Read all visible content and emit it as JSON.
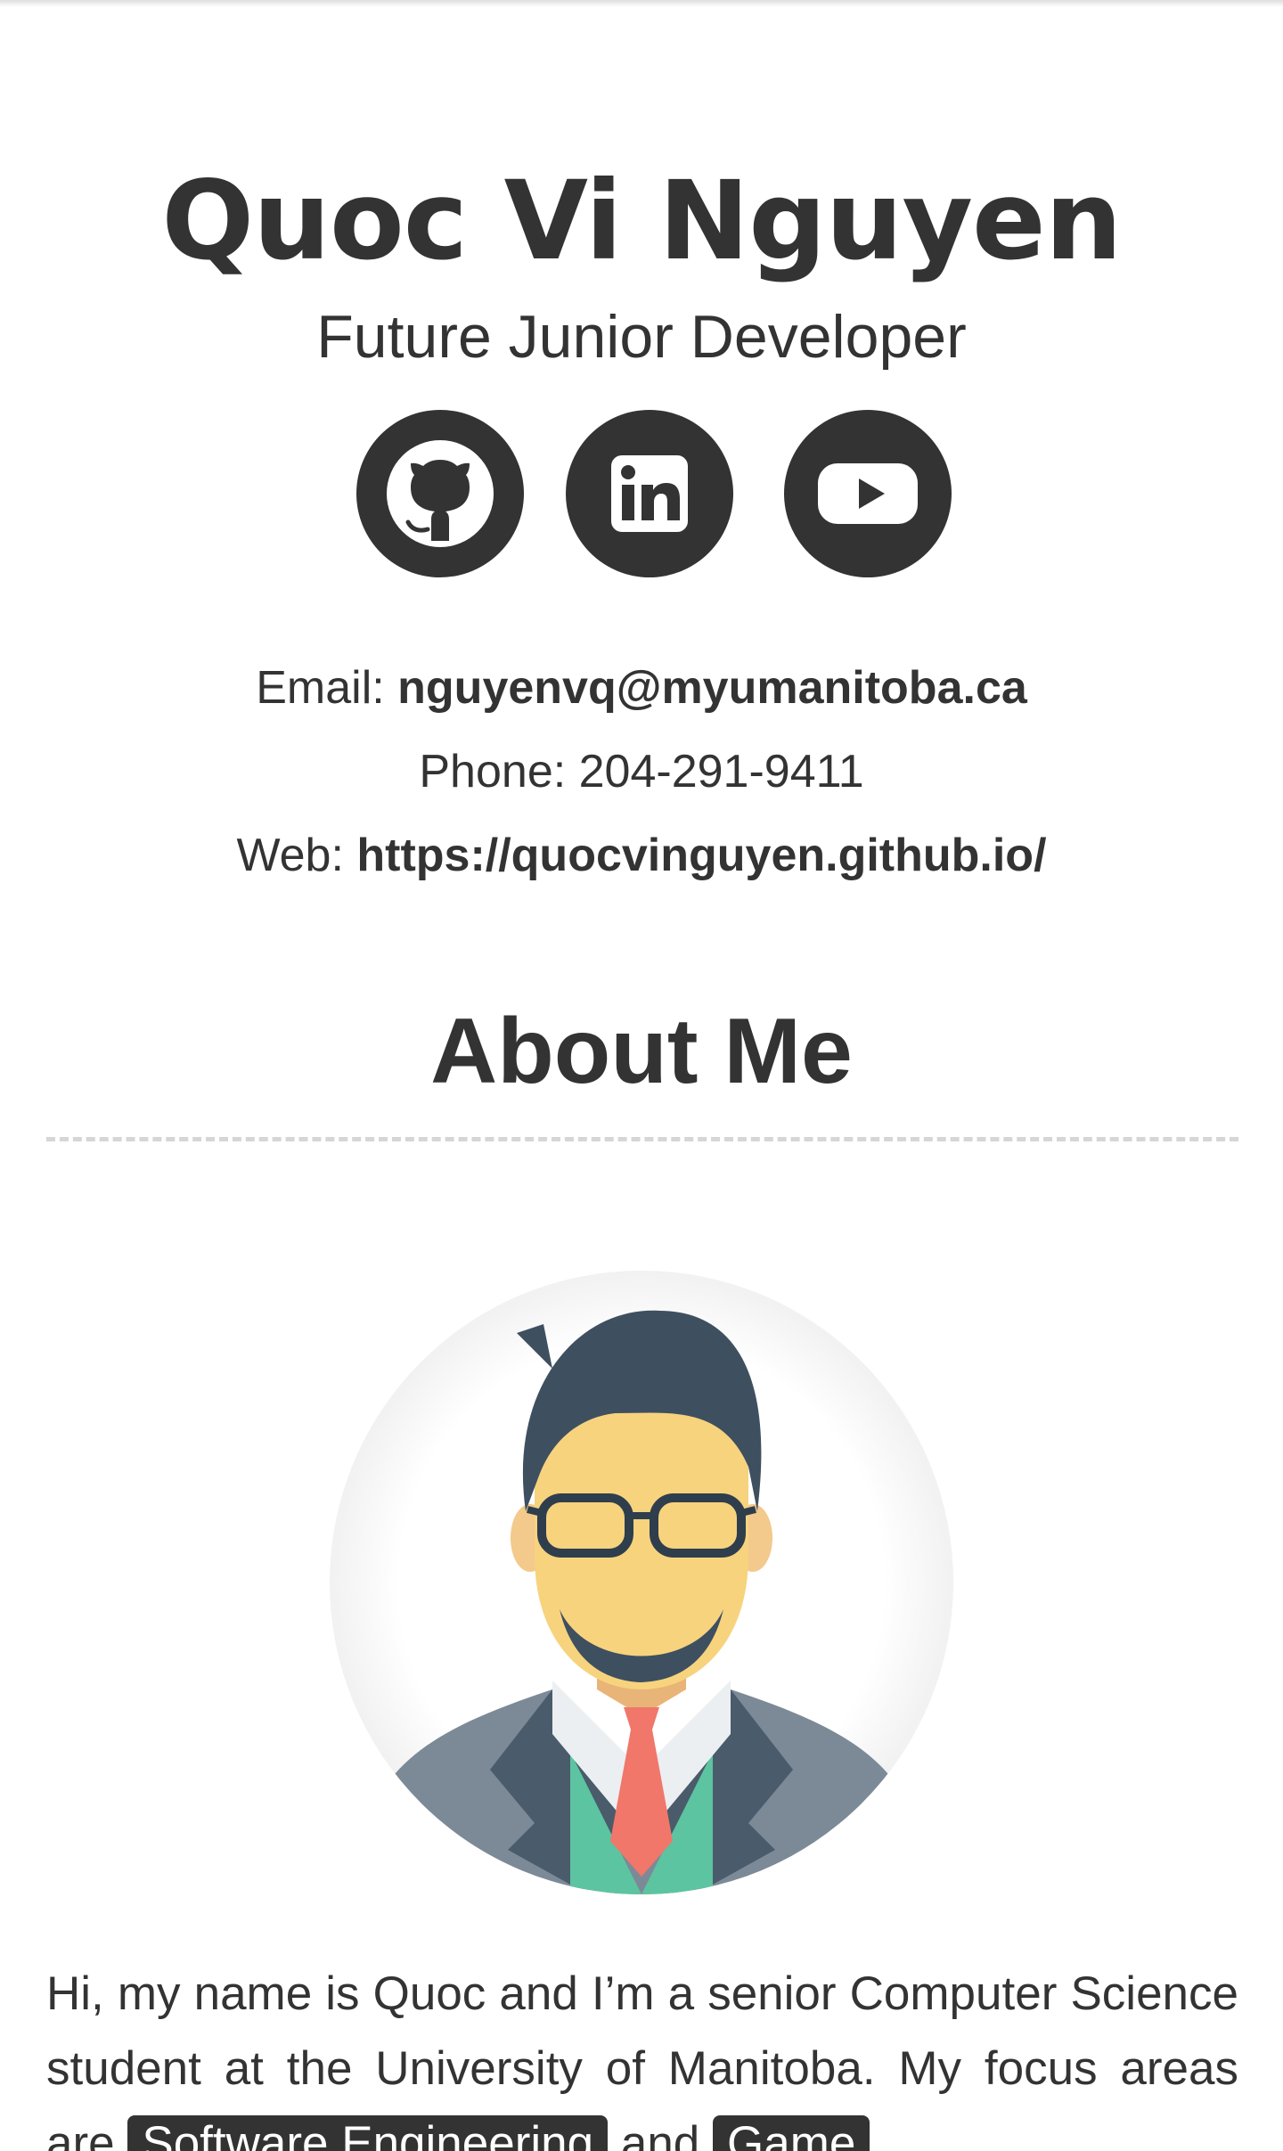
{
  "profile": {
    "name": "Quoc Vi Nguyen",
    "subtitle": "Future Junior Developer"
  },
  "social_links": [
    {
      "icon": "github-icon"
    },
    {
      "icon": "linkedin-icon"
    },
    {
      "icon": "youtube-icon"
    }
  ],
  "contact": {
    "email_label": "Email:",
    "email_value": "nguyenvq@myumanitoba.ca",
    "phone_label": "Phone:",
    "phone_value": "204-291-9411",
    "web_label": "Web:",
    "web_value": "https://quocvinguyen.github.io/"
  },
  "about": {
    "heading": "About Me",
    "text_part1": "Hi, my name is Quoc and I’m a senior Computer Science student at the University of Manitoba. My focus areas are",
    "tag1": "Software Engineering",
    "text_part2": "and",
    "tag2": "Game"
  },
  "colors": {
    "text": "#333333",
    "icon_bg": "#333333",
    "divider": "#d6d6d6",
    "background": "#ffffff"
  }
}
